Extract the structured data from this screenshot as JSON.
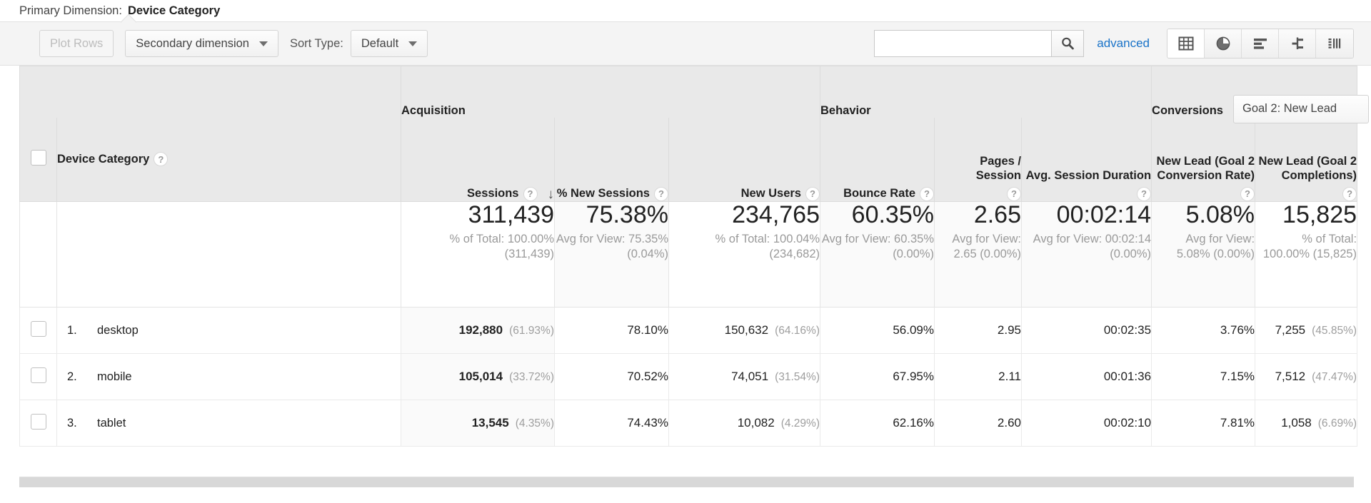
{
  "primary_dimension": {
    "label": "Primary Dimension:",
    "value": "Device Category"
  },
  "toolbar": {
    "plot_rows_label": "Plot Rows",
    "secondary_dimension_label": "Secondary dimension",
    "sort_type_label": "Sort Type:",
    "sort_type_value": "Default",
    "search_value": "",
    "search_placeholder": "",
    "search_icon": "search-icon",
    "advanced_label": "advanced",
    "view_buttons": [
      {
        "name": "table-view",
        "icon": "table-grid-icon",
        "active": true
      },
      {
        "name": "percentage-view",
        "icon": "pie-chart-icon",
        "active": false
      },
      {
        "name": "performance-view",
        "icon": "bar-chart-icon",
        "active": false
      },
      {
        "name": "comparison-view",
        "icon": "comparison-icon",
        "active": false
      },
      {
        "name": "pivot-view",
        "icon": "pivot-table-icon",
        "active": false
      }
    ]
  },
  "table": {
    "groups": {
      "acquisition": "Acquisition",
      "behavior": "Behavior",
      "conversions": "Conversions",
      "goal_selector_value": "Goal 2: New Lead"
    },
    "dimension_header": "Device Category",
    "columns": [
      {
        "id": "sessions",
        "label": "Sessions",
        "sorted": true,
        "sort_dir": "↓"
      },
      {
        "id": "pct_new_sessions",
        "label": "% New Sessions"
      },
      {
        "id": "new_users",
        "label": "New Users"
      },
      {
        "id": "bounce_rate",
        "label": "Bounce Rate"
      },
      {
        "id": "pages_session",
        "label": "Pages / Session"
      },
      {
        "id": "avg_session_duration",
        "label": "Avg. Session Duration"
      },
      {
        "id": "goal2_conversion_rate",
        "label": "New Lead (Goal 2 Conversion Rate)"
      },
      {
        "id": "goal2_completions",
        "label": "New Lead (Goal 2 Completions)"
      }
    ],
    "totals": {
      "sessions": {
        "value": "311,439",
        "sub": "% of Total: 100.00% (311,439)"
      },
      "pct_new": {
        "value": "75.38%",
        "sub": "Avg for View: 75.35% (0.04%)"
      },
      "new_users": {
        "value": "234,765",
        "sub": "% of Total: 100.04% (234,682)"
      },
      "bounce_rate": {
        "value": "60.35%",
        "sub": "Avg for View: 60.35% (0.00%)"
      },
      "pages_session": {
        "value": "2.65",
        "sub": "Avg for View: 2.65 (0.00%)"
      },
      "avg_duration": {
        "value": "00:02:14",
        "sub": "Avg for View: 00:02:14 (0.00%)"
      },
      "goal_cvr": {
        "value": "5.08%",
        "sub": "Avg for View: 5.08% (0.00%)"
      },
      "goal_comp": {
        "value": "15,825",
        "sub": "% of Total: 100.00% (15,825)"
      }
    },
    "rows": [
      {
        "index": "1.",
        "dimension": "desktop",
        "sessions": "192,880",
        "sessions_pct": "(61.93%)",
        "pct_new": "78.10%",
        "new_users": "150,632",
        "new_users_pct": "(64.16%)",
        "bounce_rate": "56.09%",
        "pages_session": "2.95",
        "avg_duration": "00:02:35",
        "goal_cvr": "3.76%",
        "goal_comp": "7,255",
        "goal_comp_pct": "(45.85%)"
      },
      {
        "index": "2.",
        "dimension": "mobile",
        "sessions": "105,014",
        "sessions_pct": "(33.72%)",
        "pct_new": "70.52%",
        "new_users": "74,051",
        "new_users_pct": "(31.54%)",
        "bounce_rate": "67.95%",
        "pages_session": "2.11",
        "avg_duration": "00:01:36",
        "goal_cvr": "7.15%",
        "goal_comp": "7,512",
        "goal_comp_pct": "(47.47%)"
      },
      {
        "index": "3.",
        "dimension": "tablet",
        "sessions": "13,545",
        "sessions_pct": "(4.35%)",
        "pct_new": "74.43%",
        "new_users": "10,082",
        "new_users_pct": "(4.29%)",
        "bounce_rate": "62.16%",
        "pages_session": "2.60",
        "avg_duration": "00:02:10",
        "goal_cvr": "7.81%",
        "goal_comp": "1,058",
        "goal_comp_pct": "(6.69%)"
      }
    ]
  },
  "colors": {
    "link": "#1a73c8",
    "header_bg": "#e9e9e9",
    "muted_text": "#9a9a9a"
  }
}
